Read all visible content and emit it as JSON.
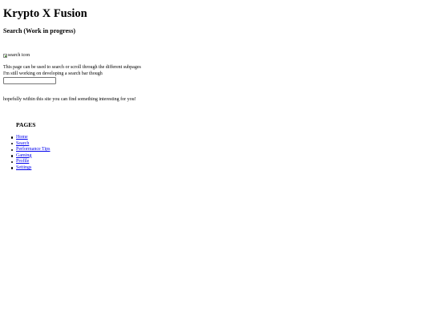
{
  "site": {
    "title": "Krypto X Fusion"
  },
  "page": {
    "heading": "Search (Work in progress)"
  },
  "search_image": {
    "alt_text": "search icon",
    "icon": "broken-image-icon"
  },
  "intro": {
    "line1": "This page can be used to search or scroll through the different subpages",
    "line2": "I'm still working on developing a search bar though"
  },
  "search": {
    "value": "",
    "placeholder": ""
  },
  "tagline": "hopefully within this site you can find something interesting for you!",
  "nav": {
    "heading": "PAGES",
    "items": [
      {
        "label": "Home"
      },
      {
        "label": "Search"
      },
      {
        "label": "Performance Tips"
      },
      {
        "label": "Gaming"
      },
      {
        "label": "Profile"
      },
      {
        "label": "Settings"
      }
    ]
  },
  "colors": {
    "link": "#0000ee",
    "text": "#000000",
    "background": "#ffffff"
  }
}
